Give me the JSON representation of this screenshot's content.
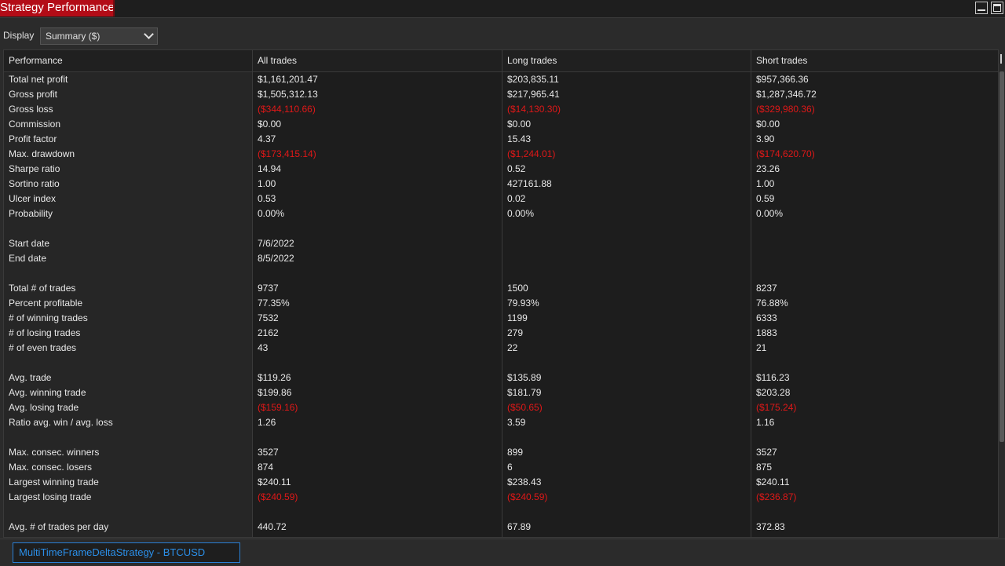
{
  "window": {
    "title": "Strategy Performance",
    "minimize_icon": "minimize-icon",
    "maximize_icon": "maximize-icon"
  },
  "toolbar": {
    "display_label": "Display",
    "display_value": "Summary ($)"
  },
  "table": {
    "headers": [
      "Performance",
      "All trades",
      "Long trades",
      "Short trades"
    ],
    "rows": [
      {
        "label": "Total net profit",
        "values": [
          "$1,161,201.47",
          "$203,835.11",
          "$957,366.36"
        ],
        "neg": [
          false,
          false,
          false
        ]
      },
      {
        "label": "Gross profit",
        "values": [
          "$1,505,312.13",
          "$217,965.41",
          "$1,287,346.72"
        ],
        "neg": [
          false,
          false,
          false
        ]
      },
      {
        "label": "Gross loss",
        "values": [
          "($344,110.66)",
          "($14,130.30)",
          "($329,980.36)"
        ],
        "neg": [
          true,
          true,
          true
        ]
      },
      {
        "label": "Commission",
        "values": [
          "$0.00",
          "$0.00",
          "$0.00"
        ],
        "neg": [
          false,
          false,
          false
        ]
      },
      {
        "label": "Profit factor",
        "values": [
          "4.37",
          "15.43",
          "3.90"
        ],
        "neg": [
          false,
          false,
          false
        ]
      },
      {
        "label": "Max. drawdown",
        "values": [
          "($173,415.14)",
          "($1,244.01)",
          "($174,620.70)"
        ],
        "neg": [
          true,
          true,
          true
        ]
      },
      {
        "label": "Sharpe ratio",
        "values": [
          "14.94",
          "0.52",
          "23.26"
        ],
        "neg": [
          false,
          false,
          false
        ]
      },
      {
        "label": "Sortino ratio",
        "values": [
          "1.00",
          "427161.88",
          "1.00"
        ],
        "neg": [
          false,
          false,
          false
        ]
      },
      {
        "label": "Ulcer index",
        "values": [
          "0.53",
          "0.02",
          "0.59"
        ],
        "neg": [
          false,
          false,
          false
        ]
      },
      {
        "label": "Probability",
        "values": [
          "0.00%",
          "0.00%",
          "0.00%"
        ],
        "neg": [
          false,
          false,
          false
        ]
      },
      {
        "label": "",
        "values": [
          "",
          "",
          ""
        ],
        "neg": [
          false,
          false,
          false
        ]
      },
      {
        "label": "Start date",
        "values": [
          "7/6/2022",
          "",
          ""
        ],
        "neg": [
          false,
          false,
          false
        ]
      },
      {
        "label": "End date",
        "values": [
          "8/5/2022",
          "",
          ""
        ],
        "neg": [
          false,
          false,
          false
        ]
      },
      {
        "label": "",
        "values": [
          "",
          "",
          ""
        ],
        "neg": [
          false,
          false,
          false
        ]
      },
      {
        "label": "Total # of trades",
        "values": [
          "9737",
          "1500",
          "8237"
        ],
        "neg": [
          false,
          false,
          false
        ]
      },
      {
        "label": "Percent profitable",
        "values": [
          "77.35%",
          "79.93%",
          "76.88%"
        ],
        "neg": [
          false,
          false,
          false
        ]
      },
      {
        "label": "# of winning trades",
        "values": [
          "7532",
          "1199",
          "6333"
        ],
        "neg": [
          false,
          false,
          false
        ]
      },
      {
        "label": "# of losing trades",
        "values": [
          "2162",
          "279",
          "1883"
        ],
        "neg": [
          false,
          false,
          false
        ]
      },
      {
        "label": "# of even trades",
        "values": [
          "43",
          "22",
          "21"
        ],
        "neg": [
          false,
          false,
          false
        ]
      },
      {
        "label": "",
        "values": [
          "",
          "",
          ""
        ],
        "neg": [
          false,
          false,
          false
        ]
      },
      {
        "label": "Avg. trade",
        "values": [
          "$119.26",
          "$135.89",
          "$116.23"
        ],
        "neg": [
          false,
          false,
          false
        ]
      },
      {
        "label": "Avg. winning trade",
        "values": [
          "$199.86",
          "$181.79",
          "$203.28"
        ],
        "neg": [
          false,
          false,
          false
        ]
      },
      {
        "label": "Avg. losing trade",
        "values": [
          "($159.16)",
          "($50.65)",
          "($175.24)"
        ],
        "neg": [
          true,
          true,
          true
        ]
      },
      {
        "label": "Ratio avg. win / avg. loss",
        "values": [
          "1.26",
          "3.59",
          "1.16"
        ],
        "neg": [
          false,
          false,
          false
        ]
      },
      {
        "label": "",
        "values": [
          "",
          "",
          ""
        ],
        "neg": [
          false,
          false,
          false
        ]
      },
      {
        "label": "Max. consec. winners",
        "values": [
          "3527",
          "899",
          "3527"
        ],
        "neg": [
          false,
          false,
          false
        ]
      },
      {
        "label": "Max. consec. losers",
        "values": [
          "874",
          "6",
          "875"
        ],
        "neg": [
          false,
          false,
          false
        ]
      },
      {
        "label": "Largest winning trade",
        "values": [
          "$240.11",
          "$238.43",
          "$240.11"
        ],
        "neg": [
          false,
          false,
          false
        ]
      },
      {
        "label": "Largest losing trade",
        "values": [
          "($240.59)",
          "($240.59)",
          "($236.87)"
        ],
        "neg": [
          true,
          true,
          true
        ]
      },
      {
        "label": "",
        "values": [
          "",
          "",
          ""
        ],
        "neg": [
          false,
          false,
          false
        ]
      },
      {
        "label": "Avg. # of trades per day",
        "values": [
          "440.72",
          "67.89",
          "372.83"
        ],
        "neg": [
          false,
          false,
          false
        ]
      }
    ]
  },
  "bottom": {
    "strategy_tab": "MultiTimeFrameDeltaStrategy - BTCUSD"
  },
  "colors": {
    "title_tab": "#b30c17",
    "negative": "#e01818",
    "strategy_tab_text": "#2b8fe8"
  }
}
